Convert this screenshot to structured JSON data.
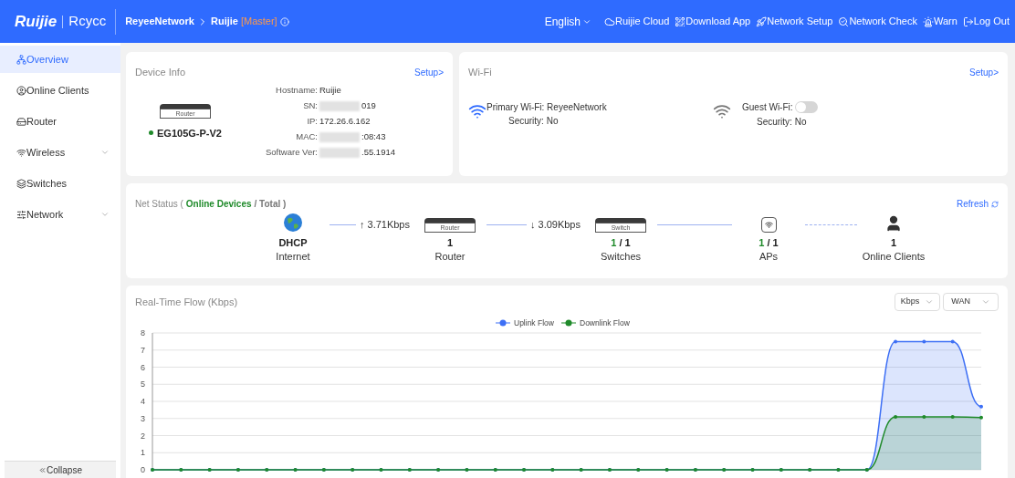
{
  "header": {
    "logo": "Ruijie",
    "logo_2": "Rcycc",
    "breadcrumb": [
      "ReyeeNetwork",
      "Ruijie"
    ],
    "role": "[Master]",
    "language": "English",
    "links": [
      {
        "kind": "cloud",
        "label": "Ruijie Cloud"
      },
      {
        "kind": "qr",
        "label": "Download App"
      },
      {
        "kind": "setup",
        "label": "Network Setup"
      },
      {
        "kind": "check",
        "label": "Network Check"
      },
      {
        "kind": "warn",
        "label": "Warn"
      },
      {
        "kind": "logout",
        "label": "Log Out"
      }
    ]
  },
  "sidebar": {
    "items": [
      {
        "kind": "overview",
        "label": "Overview",
        "selected": true
      },
      {
        "kind": "clients",
        "label": "Online Clients",
        "selected": false
      },
      {
        "kind": "router",
        "label": "Router",
        "selected": false
      },
      {
        "kind": "wireless",
        "label": "Wireless",
        "selected": false,
        "submenu": true
      },
      {
        "kind": "switches",
        "label": "Switches",
        "selected": false
      },
      {
        "kind": "network",
        "label": "Network",
        "selected": false,
        "submenu": true
      }
    ],
    "collapse": "Collapse"
  },
  "device_info": {
    "title": "Device Info",
    "setup": "Setup>",
    "device_label": "Router",
    "model": "EG105G-P-V2",
    "fields": [
      {
        "label": "Hostname:",
        "value": "Ruijie",
        "masked": false
      },
      {
        "label": "SN:",
        "value": "019",
        "masked": true
      },
      {
        "label": "IP:",
        "value": "172.26.6.162",
        "masked": false
      },
      {
        "label": "MAC:",
        "value": ":08:43",
        "masked": true
      },
      {
        "label": "Software Ver:",
        "value": ".55.1914",
        "masked": true
      }
    ]
  },
  "wifi": {
    "title": "Wi-Fi",
    "setup": "Setup>",
    "primary": {
      "label": "Primary Wi-Fi:",
      "value": "ReyeeNetwork",
      "security_label": "Security:",
      "security": "No"
    },
    "guest": {
      "label": "Guest Wi-Fi:",
      "on": false,
      "security_label": "Security:",
      "security": "No"
    }
  },
  "net_status": {
    "title": "Net Status (",
    "online_label": "Online Devices",
    "total_label": "/ Total )",
    "refresh": "Refresh",
    "nodes": [
      {
        "kind": "internet",
        "count": "DHCP",
        "label": "Internet",
        "rate": "↑ 3.71Kbps"
      },
      {
        "kind": "router",
        "device_label": "Router",
        "count": "1",
        "label": "Router",
        "rate": "↓ 3.09Kbps"
      },
      {
        "kind": "switch",
        "device_label": "Switch",
        "count": "1",
        "count_rest": "/ 1",
        "label": "Switches"
      },
      {
        "kind": "ap",
        "count": "1",
        "count_rest": "/ 1",
        "label": "APs"
      },
      {
        "kind": "clients",
        "count": "1",
        "label": "Online Clients"
      }
    ]
  },
  "flow": {
    "title": "Real-Time Flow (Kbps)",
    "unit_select": "Kbps",
    "port_select": "WAN",
    "chart_data": {
      "type": "area",
      "grid": true,
      "legend": "top",
      "ylim": [
        0,
        8
      ],
      "yticks": [
        0,
        1,
        2,
        3,
        4,
        5,
        6,
        7,
        8
      ],
      "series": [
        {
          "name": "Uplink Flow",
          "color": "#3d6ff5",
          "values": [
            0,
            0,
            0,
            0,
            0,
            0,
            0,
            0,
            0,
            0,
            0,
            0,
            0,
            0,
            0,
            0,
            0,
            0,
            0,
            0,
            0,
            0,
            0,
            0,
            0,
            0,
            7.5,
            7.5,
            7.5,
            3.7
          ]
        },
        {
          "name": "Downlink Flow",
          "color": "#1f8a2a",
          "values": [
            0,
            0,
            0,
            0,
            0,
            0,
            0,
            0,
            0,
            0,
            0,
            0,
            0,
            0,
            0,
            0,
            0,
            0,
            0,
            0,
            0,
            0,
            0,
            0,
            0,
            0,
            3.1,
            3.1,
            3.1,
            3.05
          ]
        }
      ]
    }
  }
}
